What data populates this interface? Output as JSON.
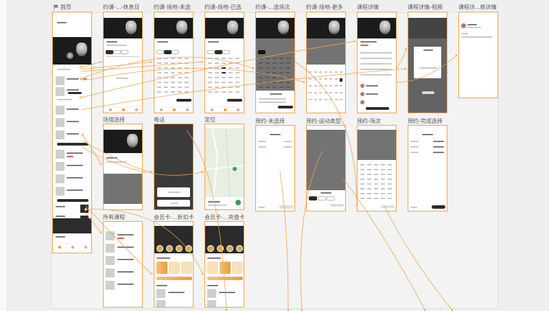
{
  "canvas": {
    "arrow_color": "#f0a24a",
    "border_color": "#f0a24a"
  },
  "boards": {
    "home": {
      "label": "首页",
      "icon": "flag-icon"
    },
    "book_rest": {
      "label": "约课-...-休息日"
    },
    "book_venue_unselected": {
      "label": "约课-场地-未选"
    },
    "book_venue_selected": {
      "label": "约课-场地-已选"
    },
    "book_select_slot": {
      "label": "约课-...选场次"
    },
    "book_venue_more": {
      "label": "约课-场地-更多"
    },
    "course_detail": {
      "label": "课程详情"
    },
    "course_detail_video": {
      "label": "课程详情-视频"
    },
    "course_detail_coach": {
      "label": "课程详...练详情"
    },
    "venue_select": {
      "label": "场馆选择"
    },
    "phone": {
      "label": "电话"
    },
    "location": {
      "label": "定位"
    },
    "reserve_unselected": {
      "label": "预约-未选择"
    },
    "reserve_sport_type": {
      "label": "预约-运动类型"
    },
    "reserve_slot": {
      "label": "预约-场次"
    },
    "reserve_done": {
      "label": "预约-完成选择"
    },
    "all_courses": {
      "label": "所有课程"
    },
    "membership_discount": {
      "label": "会员卡-...折扣卡"
    },
    "membership_stored": {
      "label": "会员卡-...充值卡"
    }
  },
  "icons": [
    "flag-icon",
    "badminton-shuttlecock-icon",
    "map-pin-icon",
    "avatar-icon",
    "coin-icon"
  ]
}
